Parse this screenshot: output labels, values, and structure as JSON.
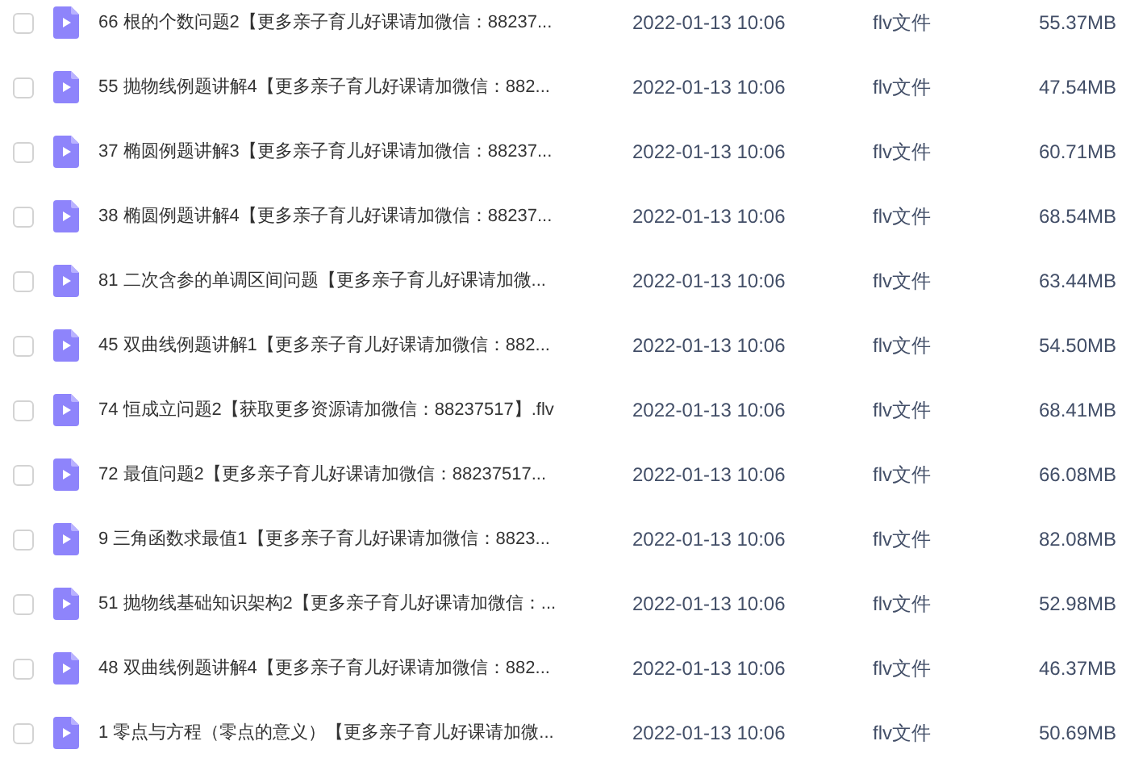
{
  "files": [
    {
      "name": "66 根的个数问题2【更多亲子育儿好课请加微信：88237...",
      "modified": "2022-01-13 10:06",
      "type": "flv文件",
      "size": "55.37MB",
      "checked": false
    },
    {
      "name": "55 抛物线例题讲解4【更多亲子育儿好课请加微信：882...",
      "modified": "2022-01-13 10:06",
      "type": "flv文件",
      "size": "47.54MB",
      "checked": false
    },
    {
      "name": "37 椭圆例题讲解3【更多亲子育儿好课请加微信：88237...",
      "modified": "2022-01-13 10:06",
      "type": "flv文件",
      "size": "60.71MB",
      "checked": false
    },
    {
      "name": "38 椭圆例题讲解4【更多亲子育儿好课请加微信：88237...",
      "modified": "2022-01-13 10:06",
      "type": "flv文件",
      "size": "68.54MB",
      "checked": false
    },
    {
      "name": "81 二次含参的单调区间问题【更多亲子育儿好课请加微...",
      "modified": "2022-01-13 10:06",
      "type": "flv文件",
      "size": "63.44MB",
      "checked": false
    },
    {
      "name": "45 双曲线例题讲解1【更多亲子育儿好课请加微信：882...",
      "modified": "2022-01-13 10:06",
      "type": "flv文件",
      "size": "54.50MB",
      "checked": false
    },
    {
      "name": "74 恒成立问题2【获取更多资源请加微信：88237517】.flv",
      "modified": "2022-01-13 10:06",
      "type": "flv文件",
      "size": "68.41MB",
      "checked": false
    },
    {
      "name": "72 最值问题2【更多亲子育儿好课请加微信：88237517...",
      "modified": "2022-01-13 10:06",
      "type": "flv文件",
      "size": "66.08MB",
      "checked": false
    },
    {
      "name": "9 三角函数求最值1【更多亲子育儿好课请加微信：8823...",
      "modified": "2022-01-13 10:06",
      "type": "flv文件",
      "size": "82.08MB",
      "checked": false
    },
    {
      "name": "51 抛物线基础知识架构2【更多亲子育儿好课请加微信：...",
      "modified": "2022-01-13 10:06",
      "type": "flv文件",
      "size": "52.98MB",
      "checked": false
    },
    {
      "name": "48 双曲线例题讲解4【更多亲子育儿好课请加微信：882...",
      "modified": "2022-01-13 10:06",
      "type": "flv文件",
      "size": "46.37MB",
      "checked": false
    },
    {
      "name": "1 零点与方程（零点的意义）【更多亲子育儿好课请加微...",
      "modified": "2022-01-13 10:06",
      "type": "flv文件",
      "size": "50.69MB",
      "checked": false
    }
  ]
}
